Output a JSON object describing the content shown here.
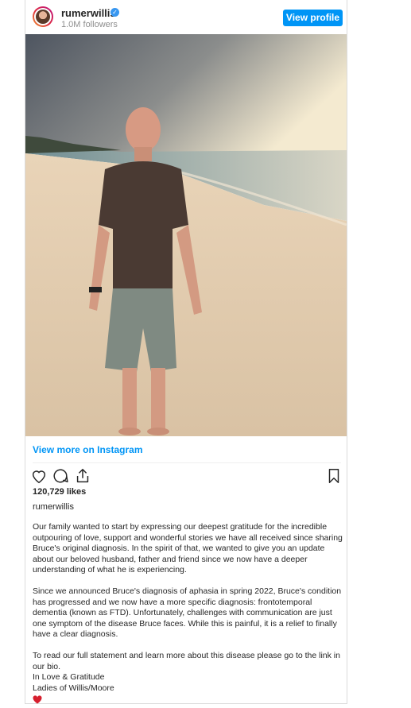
{
  "header": {
    "username": "rumerwillis",
    "followers": "1.0M followers",
    "view_profile_label": "View profile"
  },
  "post": {
    "image_alt_subject": "Man standing on a sandy beach",
    "view_more_label": "View more on Instagram",
    "likes": "120,729 likes",
    "caption_username": "rumerwillis",
    "caption_lines": [
      "Our family wanted to start by expressing our deepest gratitude for the incredible",
      "outpouring of love, support and wonderful stories we have all received since sharing",
      "Bruce's original diagnosis. In the spirit of that, we wanted to give you an update",
      "about our beloved husband, father and friend since we now have a deeper",
      "understanding of what he is experiencing.",
      "",
      "Since we announced Bruce's diagnosis of aphasia in spring 2022, Bruce's condition",
      "has progressed and we now have a more specific diagnosis: frontotemporal",
      "dementia (known as FTD). Unfortunately, challenges with communication are just",
      "one symptom of the disease Bruce faces. While this is painful, it is a relief to finally",
      "have a clear diagnosis.",
      "",
      "To read our full statement and learn more about this disease please go to the link in",
      "our bio.",
      "In Love & Gratitude",
      "Ladies of Willis/Moore"
    ]
  },
  "icons": [
    "heart-icon",
    "comment-icon",
    "share-icon",
    "bookmark-icon",
    "verified-badge-icon",
    "red-heart-emoji"
  ],
  "colors": {
    "accent": "#0095f6",
    "text": "#262626",
    "muted": "#8e8e8e",
    "heart": "#e0245e"
  }
}
